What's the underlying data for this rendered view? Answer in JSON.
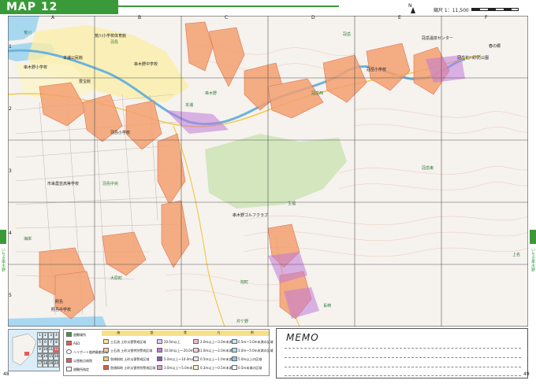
{
  "header": {
    "title": "MAP 12",
    "accent": "#3a9a3a"
  },
  "north": {
    "label": "N"
  },
  "scale": {
    "label": "縮尺 1：11,500"
  },
  "grid": {
    "columns": [
      "A",
      "B",
      "C",
      "D",
      "E",
      "F"
    ],
    "rows": [
      "1",
      "2",
      "3",
      "4",
      "5"
    ]
  },
  "side": {
    "left_text": "いちき串木野",
    "right_text": "いちき串木野"
  },
  "pages": {
    "left": "48",
    "right": "49"
  },
  "memo": {
    "title": "MEMO"
  },
  "legend": {
    "header_items": [
      "施",
      "設",
      "等",
      "凡",
      "例"
    ],
    "facilities": [
      {
        "icon": "house-icon",
        "label": "避難場所"
      },
      {
        "icon": "aed-icon",
        "label": "AED"
      },
      {
        "icon": "heli-icon",
        "label": "ヘリポート臨時離着陸場"
      },
      {
        "icon": "hospital-icon",
        "label": "災害拠点病院"
      },
      {
        "icon": "flag-icon",
        "label": "避難所指定"
      }
    ],
    "hazards": [
      {
        "color": "#fbe3a0",
        "label": "土石流 土砂災害警戒区域"
      },
      {
        "color": "#f7c6a8",
        "label": "土石流 土砂災害特別警戒区域"
      },
      {
        "color": "#e9d26c",
        "label": "急傾斜地 土砂災害警戒区域"
      },
      {
        "color": "#d9603a",
        "label": "急傾斜地 土砂災害特別警戒区域"
      }
    ],
    "flood": [
      {
        "color": "#e6c8f0",
        "label": "20.0m以上"
      },
      {
        "color": "#c07ad8",
        "label": "10.0m以上～20.0m未満"
      },
      {
        "color": "#9a4fc8",
        "label": "5.0m以上～10.0m未満"
      },
      {
        "color": "#d8a0d8",
        "label": "3.0m以上～5.0m未満"
      },
      {
        "color": "#f0b8d0",
        "label": "2.0m以上～3.0m未満"
      },
      {
        "color": "#f6d0e0",
        "label": "1.0m以上～2.0m未満"
      },
      {
        "color": "#fbe0ea",
        "label": "0.5m以上～1.0m未満"
      },
      {
        "color": "#fdf0c0",
        "label": "0.3m以上～0.5m未満"
      },
      {
        "color": "#c8e8f8",
        "label": "0.5m～3.0m未満の区域"
      },
      {
        "color": "#a8d8f0",
        "label": "3.0m～5.0m未満の区域"
      },
      {
        "color": "#88c8e8",
        "label": "5.0m以上の区域"
      },
      {
        "color": "#ffffff",
        "label": "0.5m未満の区域"
      }
    ]
  },
  "index_map": {
    "cells": [
      "1",
      "2",
      "3",
      "4",
      "5",
      "6",
      "7",
      "8",
      "9",
      "10",
      "11",
      "12",
      "13",
      "14",
      "15",
      "16",
      "17",
      "18",
      "19",
      "20"
    ]
  },
  "places": [
    {
      "name": "冠岳",
      "col": "D",
      "row": "1"
    },
    {
      "name": "羽島",
      "col": "B",
      "row": "1"
    },
    {
      "name": "荒川",
      "col": "A",
      "row": "1"
    },
    {
      "name": "串木野",
      "col": "C",
      "row": "2"
    },
    {
      "name": "冠岳西",
      "col": "D",
      "row": "2"
    },
    {
      "name": "本浦",
      "col": "C",
      "row": "2"
    },
    {
      "name": "冠岳東",
      "col": "E",
      "row": "3"
    },
    {
      "name": "羽島中央",
      "col": "B",
      "row": "3"
    },
    {
      "name": "春の郷",
      "col": "F",
      "row": "1"
    },
    {
      "name": "串木野ゴルフクラブ",
      "col": "C",
      "row": "3"
    },
    {
      "name": "照島",
      "col": "A",
      "row": "5"
    },
    {
      "name": "長崎",
      "col": "D",
      "row": "5"
    },
    {
      "name": "生福",
      "col": "D",
      "row": "4"
    },
    {
      "name": "海岸",
      "col": "A",
      "row": "4"
    },
    {
      "name": "旭町",
      "col": "C",
      "row": "4"
    },
    {
      "name": "大原町",
      "col": "B",
      "row": "4"
    },
    {
      "name": "芹ケ野",
      "col": "E",
      "row": "4"
    },
    {
      "name": "上名",
      "col": "F",
      "row": "3"
    }
  ],
  "facilities_on_map": [
    "荒川小学校体育館",
    "本浦公民館",
    "串木野中学校",
    "串木野小学校",
    "冠岳温泉センター",
    "冠岳花川砂防公園",
    "豊宝館",
    "照島中学校",
    "市来農芸高等学校",
    "冠岳小学校",
    "羽島小学校"
  ]
}
